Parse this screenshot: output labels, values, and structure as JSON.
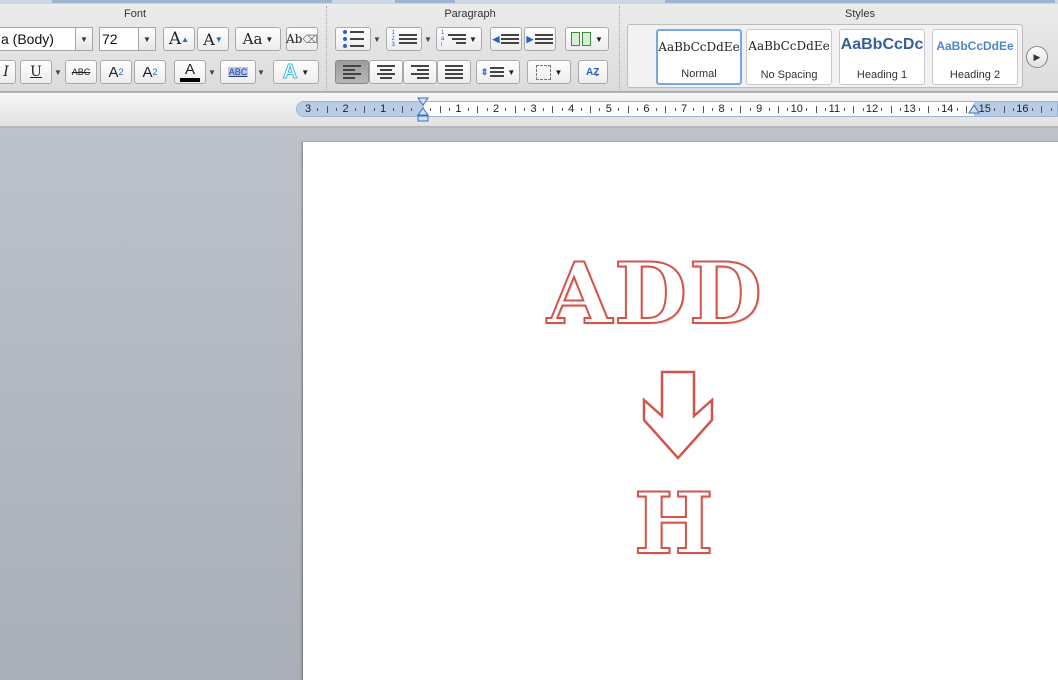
{
  "ribbon": {
    "groups": {
      "font": "Font",
      "paragraph": "Paragraph",
      "styles": "Styles"
    },
    "font": {
      "font_name": "a (Body)",
      "font_size": "72",
      "grow_label": "A",
      "shrink_label": "A",
      "change_case_label": "Aa",
      "clear_format_label": "Ab",
      "italic_label": "I",
      "underline_label": "U",
      "strike_label": "ABC",
      "superscript_label": "A",
      "superscript_mark": "2",
      "subscript_label": "A",
      "subscript_mark": "2",
      "font_color_label": "A",
      "highlight_label": "ABC",
      "text_effects_label": "A",
      "font_color": "#000000",
      "effects_color": "#5bc8e8"
    },
    "paragraph": {
      "numbered_marks": "1 2 3",
      "multilevel_marks": "1 a i",
      "sort_label": "AZ"
    },
    "styles": [
      {
        "sample": "AaBbCcDdEe",
        "name": "Normal",
        "active": true
      },
      {
        "sample": "AaBbCcDdEe",
        "name": "No Spacing",
        "active": false
      },
      {
        "sample": "AaBbCcDc",
        "name": "Heading 1",
        "active": false
      },
      {
        "sample": "AaBbCcDdEe",
        "name": "Heading 2",
        "active": false
      }
    ]
  },
  "ruler": {
    "labels": [
      "3",
      "2",
      "1",
      "",
      "1",
      "2",
      "3",
      "4",
      "5",
      "6",
      "7",
      "8",
      "9",
      "10",
      "11",
      "12",
      "13",
      "14",
      "15",
      "16",
      "1"
    ]
  },
  "document": {
    "line1": "ADD",
    "line2": "H",
    "text_outline_color": "#d2554d"
  }
}
